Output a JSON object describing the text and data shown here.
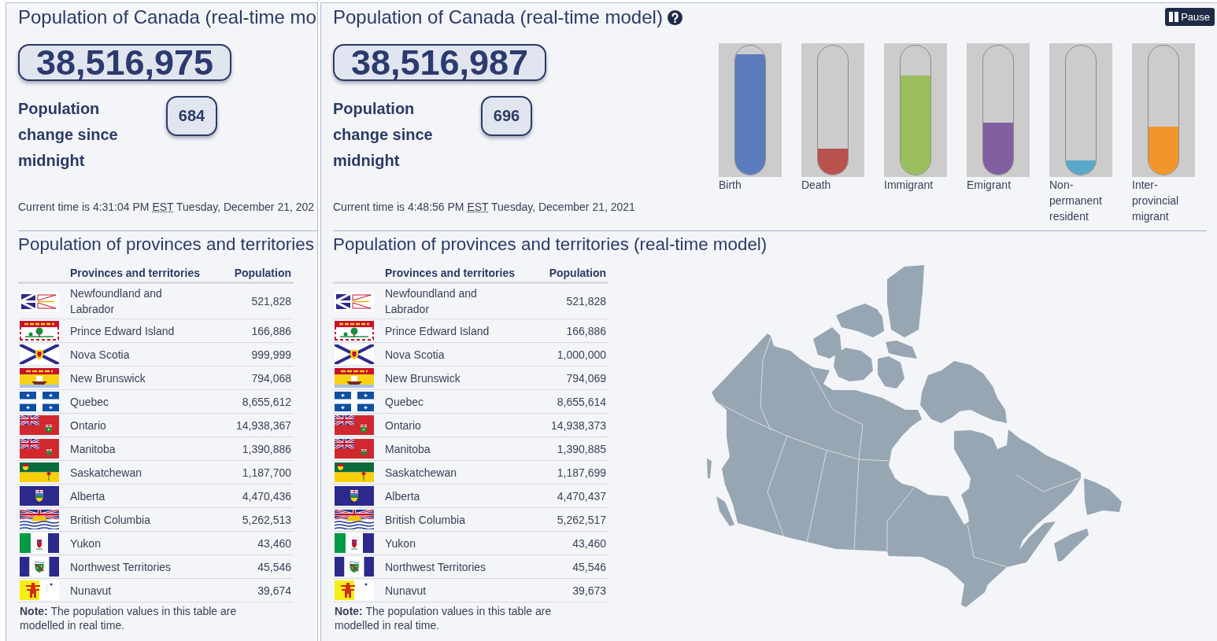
{
  "panels": [
    {
      "kind": "clipped",
      "title": "Population of Canada (real-time mo",
      "population": "38,516,975",
      "change_label": "Population change since midnight",
      "change_value": "684",
      "current_time": {
        "text": "Current time is 4:31:04 PM",
        "zone": "EST",
        "date": "Tuesday, December 21, 202"
      },
      "provinces": {
        "title": "Population of provinces and territories",
        "columns": [
          "Provinces and territories",
          "Population"
        ],
        "rows": [
          {
            "name": "Newfoundland and Labrador",
            "population": "521,828"
          },
          {
            "name": "Prince Edward Island",
            "population": "166,886"
          },
          {
            "name": "Nova Scotia",
            "population": "999,999"
          },
          {
            "name": "New Brunswick",
            "population": "794,068"
          },
          {
            "name": "Quebec",
            "population": "8,655,612"
          },
          {
            "name": "Ontario",
            "population": "14,938,367"
          },
          {
            "name": "Manitoba",
            "population": "1,390,886"
          },
          {
            "name": "Saskatchewan",
            "population": "1,187,700"
          },
          {
            "name": "Alberta",
            "population": "4,470,436"
          },
          {
            "name": "British Columbia",
            "population": "5,262,513"
          },
          {
            "name": "Yukon",
            "population": "43,460"
          },
          {
            "name": "Northwest Territories",
            "population": "45,546"
          },
          {
            "name": "Nunavut",
            "population": "39,674"
          }
        ],
        "note": "**Note:** The population values in this table are modelled in real time."
      }
    },
    {
      "kind": "full",
      "title": "Population of Canada (real-time model)",
      "pause_button": "Pause",
      "population": "38,516,987",
      "change_label": "Population change since midnight",
      "change_value": "696",
      "current_time": {
        "text": "Current time is 4:48:56 PM",
        "zone": "EST",
        "date": "Tuesday, December 21, 2021"
      },
      "gauges": [
        {
          "label": "Birth",
          "level": 0.93,
          "color": "#5a7bbd"
        },
        {
          "label": "Death",
          "level": 0.2,
          "color": "#b9524c"
        },
        {
          "label": "Immigrant",
          "level": 0.77,
          "color": "#9bbf5f"
        },
        {
          "label": "Emigrant",
          "level": 0.4,
          "color": "#825fa0"
        },
        {
          "label": "Non-permanent resident",
          "level": 0.11,
          "color": "#58a8c8"
        },
        {
          "label": "Inter-provincial migrant",
          "level": 0.37,
          "color": "#f0962b"
        }
      ],
      "provinces": {
        "title": "Population of provinces and territories (real-time model)",
        "columns": [
          "Provinces and territories",
          "Population"
        ],
        "rows": [
          {
            "name": "Newfoundland and Labrador",
            "population": "521,828"
          },
          {
            "name": "Prince Edward Island",
            "population": "166,886"
          },
          {
            "name": "Nova Scotia",
            "population": "1,000,000"
          },
          {
            "name": "New Brunswick",
            "population": "794,069"
          },
          {
            "name": "Quebec",
            "population": "8,655,614"
          },
          {
            "name": "Ontario",
            "population": "14,938,373"
          },
          {
            "name": "Manitoba",
            "population": "1,390,885"
          },
          {
            "name": "Saskatchewan",
            "population": "1,187,699"
          },
          {
            "name": "Alberta",
            "population": "4,470,437"
          },
          {
            "name": "British Columbia",
            "population": "5,262,517"
          },
          {
            "name": "Yukon",
            "population": "43,460"
          },
          {
            "name": "Northwest Territories",
            "population": "45,546"
          },
          {
            "name": "Nunavut",
            "population": "39,673"
          }
        ],
        "note": "**Note:** The population values in this table are modelled in real time."
      }
    }
  ]
}
